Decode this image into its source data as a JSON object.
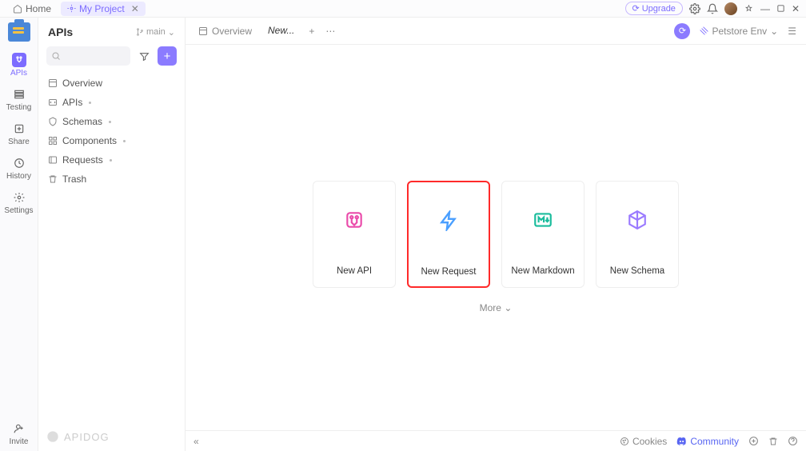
{
  "titlebar": {
    "home_label": "Home",
    "project_label": "My Project",
    "upgrade_label": "Upgrade"
  },
  "rail": {
    "apis": "APIs",
    "testing": "Testing",
    "share": "Share",
    "history": "History",
    "settings": "Settings",
    "invite": "Invite"
  },
  "sidebar": {
    "title": "APIs",
    "branch": "main",
    "search_placeholder": "",
    "tree": {
      "overview": "Overview",
      "apis": "APIs",
      "schemas": "Schemas",
      "components": "Components",
      "requests": "Requests",
      "trash": "Trash"
    },
    "footer_brand": "APIDOG"
  },
  "tabs": {
    "overview": "Overview",
    "new": "New...",
    "env_label": "Petstore Env"
  },
  "cards": {
    "new_api": "New API",
    "new_request": "New Request",
    "new_markdown": "New Markdown",
    "new_schema": "New Schema",
    "more": "More"
  },
  "footer": {
    "cookies": "Cookies",
    "community": "Community"
  },
  "colors": {
    "accent": "#8b7bff",
    "highlight": "#ff2a2a"
  }
}
